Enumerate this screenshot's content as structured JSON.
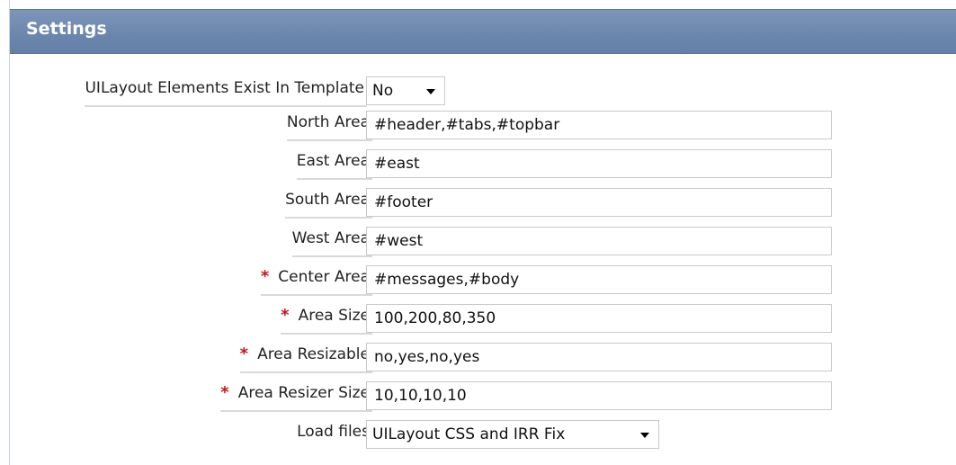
{
  "panel": {
    "title": "Settings"
  },
  "fields": {
    "elements_exist": {
      "label": "UILayout Elements Exist In Template",
      "value": "No",
      "required": false
    },
    "north_area": {
      "label": "North Area",
      "value": "#header,#tabs,#topbar",
      "required": false
    },
    "east_area": {
      "label": "East Area",
      "value": "#east",
      "required": false
    },
    "south_area": {
      "label": "South Area",
      "value": "#footer",
      "required": false
    },
    "west_area": {
      "label": "West Area",
      "value": "#west",
      "required": false
    },
    "center_area": {
      "label": "Center Area",
      "value": "#messages,#body",
      "required": true
    },
    "area_size": {
      "label": "Area Size",
      "value": "100,200,80,350",
      "required": true
    },
    "area_resizable": {
      "label": "Area Resizable",
      "value": "no,yes,no,yes",
      "required": true
    },
    "area_resizer_size": {
      "label": "Area Resizer Size",
      "value": "10,10,10,10",
      "required": true
    },
    "load_files": {
      "label": "Load files",
      "value": "UILayout CSS and IRR Fix",
      "required": false
    }
  },
  "required_marker": "*",
  "icons": {
    "dropdown": "chevron-down-icon",
    "required": "asterisk-icon"
  },
  "colors": {
    "header_bg": "#6b86ad",
    "required_marker": "#c4161c"
  }
}
